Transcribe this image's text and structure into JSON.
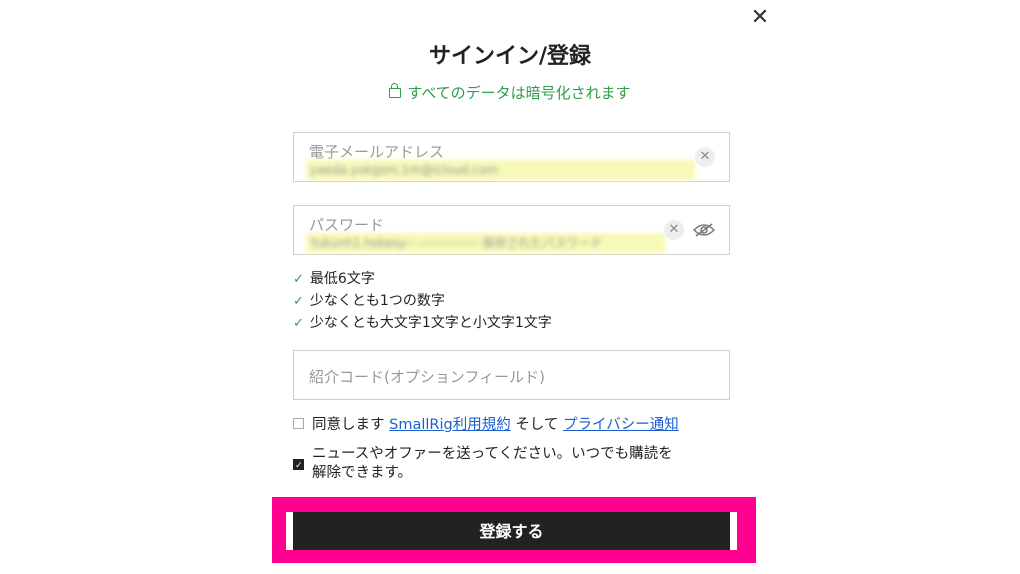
{
  "header": {
    "close_icon": "✕",
    "title": "サインイン/登録",
    "secure_note": "すべてのデータは暗号化されます"
  },
  "email": {
    "label": "電子メールアドレス",
    "value": "yaeda.yokgsm.1m@icloud.com"
  },
  "password": {
    "label": "パスワード",
    "value": "Yukunh1.hskesy-- -------------- 保存されたパスワード"
  },
  "rules": [
    {
      "check": "✓",
      "text": "最低6文字"
    },
    {
      "check": "✓",
      "text": "少なくとも1つの数字"
    },
    {
      "check": "✓",
      "text": "少なくとも大文字1文字と小文字1文字"
    }
  ],
  "referral": {
    "placeholder": "紹介コード(オプションフィールド)"
  },
  "agreement": {
    "prefix": "同意します",
    "terms_link": "SmallRig利用規約",
    "middle": "そして",
    "privacy_link": "プライバシー通知",
    "checked": false
  },
  "newsletter": {
    "line1": "ニュースやオファーを送ってください。いつでも購読を",
    "line2": "解除できます。",
    "checked": true
  },
  "submit": {
    "label": "登録する"
  },
  "colors": {
    "accent_green": "#2e9e4a",
    "highlight": "#ff0090",
    "link": "#1a5fd0",
    "button_bg": "#222222"
  }
}
